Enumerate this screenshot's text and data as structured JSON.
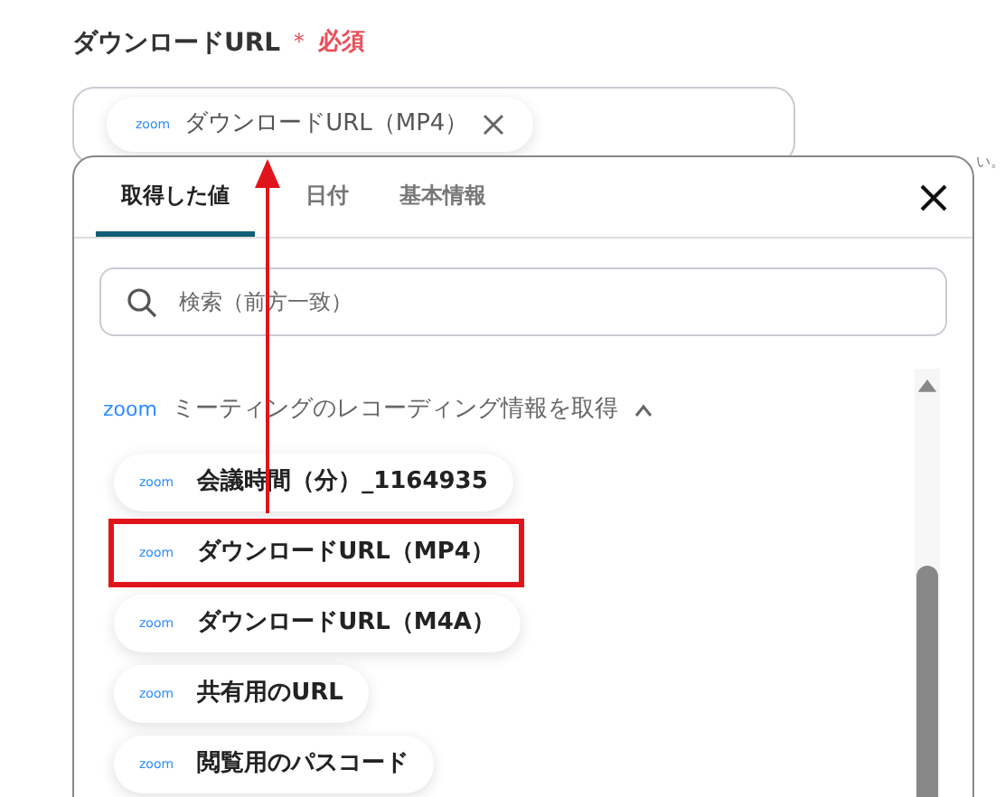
{
  "field": {
    "label": "ダウンロードURL",
    "required_mark": "＊",
    "required_text": "必須",
    "chip": {
      "logo": "zoom",
      "text": "ダウンロードURL（MP4）"
    }
  },
  "background_fragment": "い。",
  "panel": {
    "tabs": [
      {
        "label": "取得した値",
        "selected": true
      },
      {
        "label": "日付",
        "selected": false
      },
      {
        "label": "基本情報",
        "selected": false
      }
    ],
    "search": {
      "placeholder": "検索（前方一致）"
    },
    "group": {
      "logo": "zoom",
      "title": "ミーティングのレコーディング情報を取得",
      "expanded": true,
      "items": [
        {
          "logo": "zoom",
          "text": "会議時間（分）_1164935",
          "highlighted": false
        },
        {
          "logo": "zoom",
          "text": "ダウンロードURL（MP4）",
          "highlighted": true
        },
        {
          "logo": "zoom",
          "text": "ダウンロードURL（M4A）",
          "highlighted": false
        },
        {
          "logo": "zoom",
          "text": "共有用のURL",
          "highlighted": false
        },
        {
          "logo": "zoom",
          "text": "閲覧用のパスコード",
          "highlighted": false
        }
      ]
    }
  }
}
